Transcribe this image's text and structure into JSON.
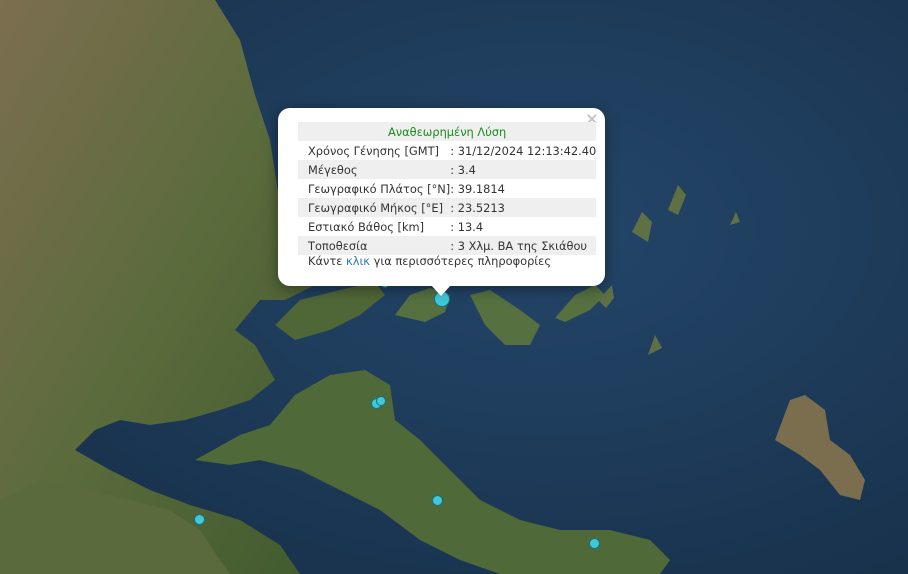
{
  "popup": {
    "title": "Αναθεωρημένη Λύση",
    "close": "×",
    "rows": [
      {
        "label": "Χρόνος Γένησης [GMT]",
        "value": ": 31/12/2024 12:13:42.40"
      },
      {
        "label": "Μέγεθος",
        "value": ": 3.4"
      },
      {
        "label": "Γεωγραφικό Πλάτος [°N]",
        "value": ": 39.1814"
      },
      {
        "label": "Γεωγραφικό Μήκος [°E]",
        "value": ": 23.5213"
      },
      {
        "label": "Εστιακό Βάθος [km]",
        "value": ": 13.4"
      },
      {
        "label": "Τοποθεσία",
        "value": ": 3 Χλμ. ΒΑ της Σκιάθου"
      }
    ],
    "more_prefix": "Κάντε ",
    "more_link": "κλικ",
    "more_suffix": " για περισσότερες πληροφορίες"
  },
  "colors": {
    "sea": "#1d3a55",
    "land": "#5c6a3a",
    "marker": "#3ec8d8",
    "title": "#1a8a1a",
    "link": "#2a7ab5"
  }
}
